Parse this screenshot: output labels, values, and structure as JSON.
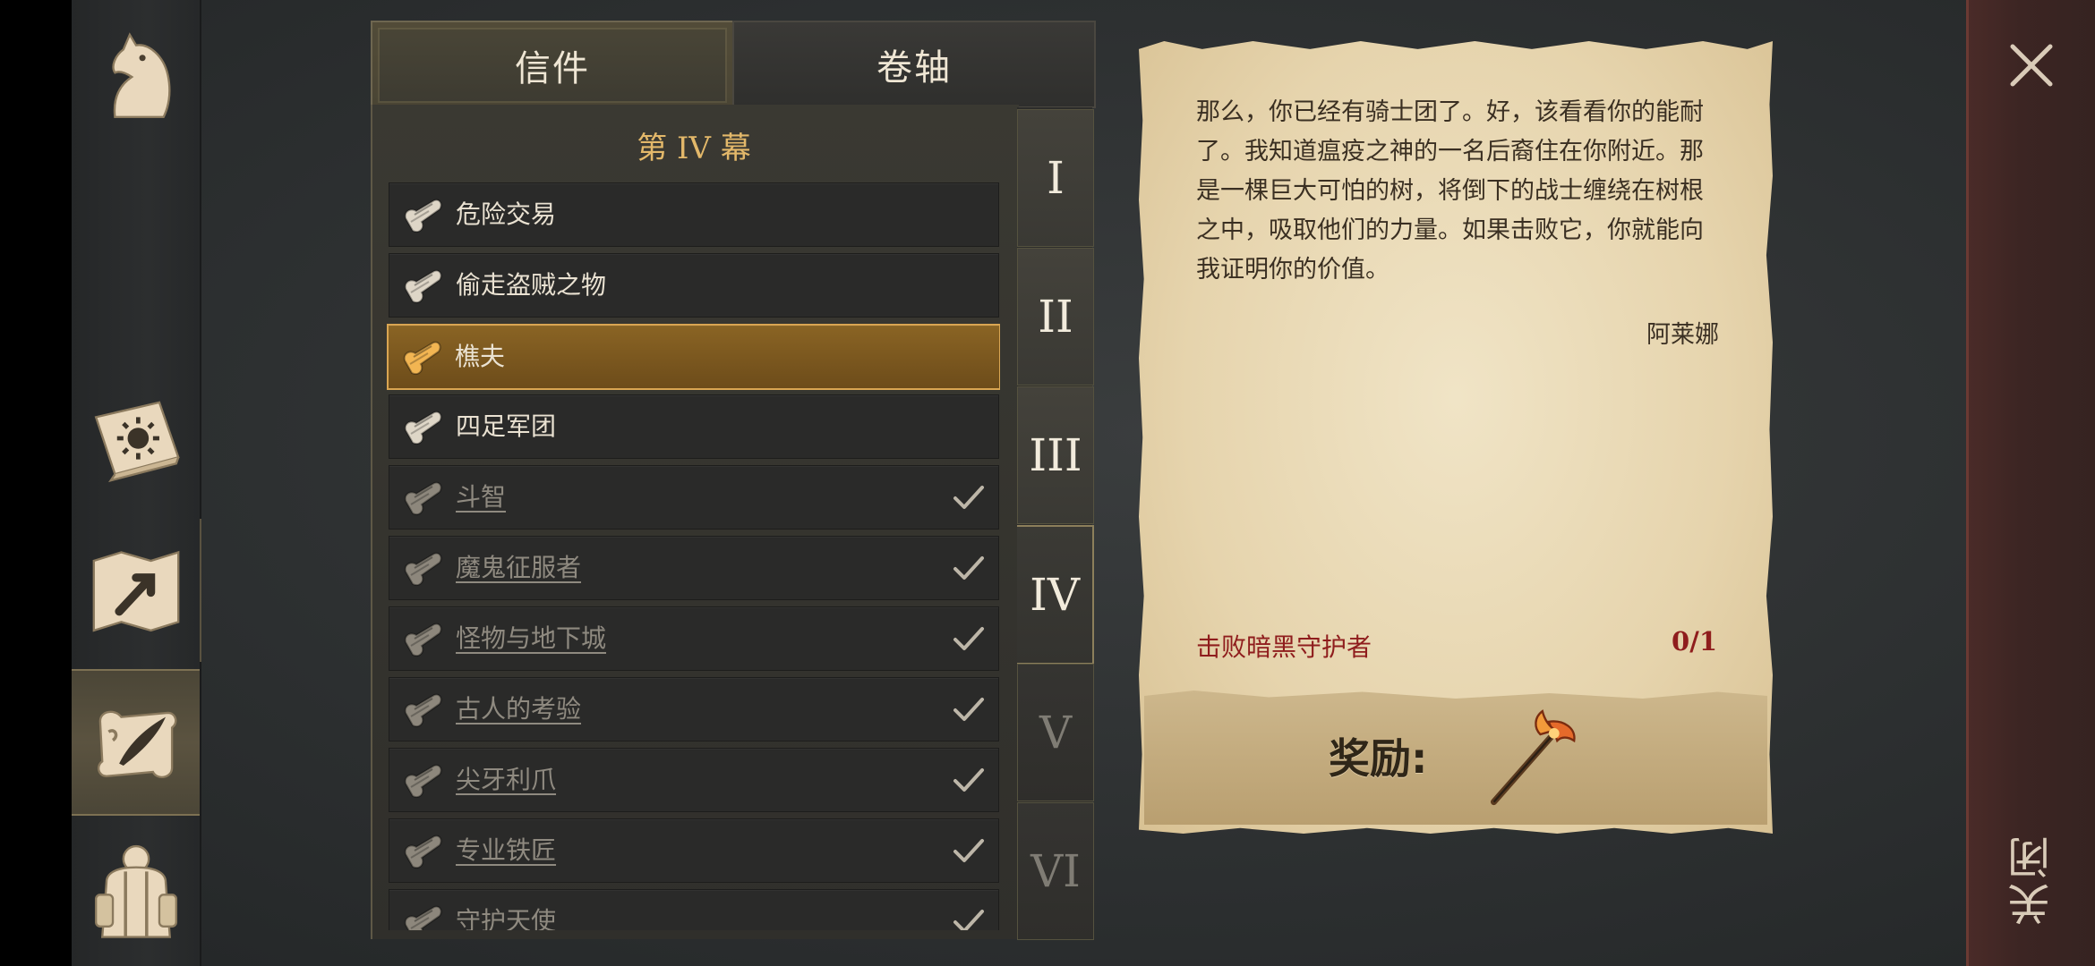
{
  "tabs": {
    "letters": "信件",
    "scrolls": "卷轴"
  },
  "act_title": "第 IV 幕",
  "quests": [
    {
      "label": "危险交易",
      "done": false,
      "selected": false
    },
    {
      "label": "偷走盗贼之物",
      "done": false,
      "selected": false
    },
    {
      "label": "樵夫",
      "done": false,
      "selected": true
    },
    {
      "label": "四足军团",
      "done": false,
      "selected": false
    },
    {
      "label": "斗智",
      "done": true,
      "selected": false
    },
    {
      "label": "魔鬼征服者",
      "done": true,
      "selected": false
    },
    {
      "label": "怪物与地下城",
      "done": true,
      "selected": false
    },
    {
      "label": "古人的考验",
      "done": true,
      "selected": false
    },
    {
      "label": "尖牙利爪",
      "done": true,
      "selected": false
    },
    {
      "label": "专业铁匠",
      "done": true,
      "selected": false
    },
    {
      "label": "守护天使",
      "done": true,
      "selected": false
    }
  ],
  "acts": [
    "I",
    "II",
    "III",
    "IV",
    "V",
    "VI"
  ],
  "active_act": "IV",
  "letter": {
    "body": "那么，你已经有骑士团了。好，该看看你的能耐了。我知道瘟疫之神的一名后裔住在你附近。那是一棵巨大可怕的树，将倒下的战士缠绕在树根之中，吸取他们的力量。如果击败它，你就能向我证明你的价值。",
    "signature": "阿莱娜",
    "objective": "击败暗黑守护者",
    "objective_progress": "0/1",
    "reward_label": "奖励:",
    "reward_icon": "fire-halberd-icon"
  },
  "close_label": "关闭",
  "colors": {
    "gold_accent": "#e3b86a",
    "objective_red": "#8f1d1d",
    "selected_item": "#8a6424"
  }
}
